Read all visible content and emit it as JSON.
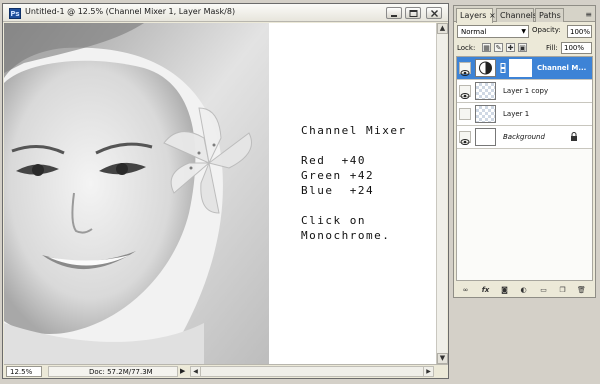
{
  "document": {
    "title": "Untitled-1 @ 12.5% (Channel Mixer 1, Layer Mask/8)",
    "app_icon_text": "Ps",
    "zoom": "12.5%",
    "doc_info": "Doc: 57.2M/77.3M",
    "canvas_text": {
      "heading": "Channel Mixer",
      "red": "Red  +40",
      "green": "Green +42",
      "blue": "Blue  +24",
      "line1": "Click on",
      "line2": "Monochrome."
    }
  },
  "layers_panel": {
    "tabs": [
      "Layers",
      "Channels",
      "Paths"
    ],
    "active_tab": "Layers",
    "blend_mode": "Normal",
    "opacity_label": "Opacity:",
    "opacity_value": "100%",
    "lock_label": "Lock:",
    "fill_label": "Fill:",
    "fill_value": "100%",
    "layers": [
      {
        "name": "Channel M...",
        "selected": true,
        "visible": true
      },
      {
        "name": "Layer 1 copy",
        "selected": false,
        "visible": true
      },
      {
        "name": "Layer 1",
        "selected": false,
        "visible": false
      },
      {
        "name": "Background",
        "selected": false,
        "visible": true,
        "locked": true
      }
    ],
    "bottom_icons": [
      "link-icon",
      "fx-icon",
      "add-mask-icon",
      "adjustment-layer-icon",
      "group-folder-icon",
      "new-layer-icon",
      "delete-layer-icon"
    ]
  },
  "colors": {
    "selected_layer": "#3d83d6",
    "panel_bg": "#ece9d8",
    "workspace_bg": "#d4d0c8"
  }
}
